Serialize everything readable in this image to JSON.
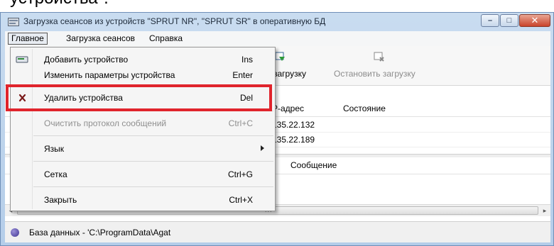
{
  "caption": "устройства\".",
  "window": {
    "title": "Загрузка сеансов из устройств \"SPRUT NR\", \"SPRUT SR\" в оперативную БД",
    "minimize_glyph": "–",
    "maximize_glyph": "□",
    "close_glyph": "✕"
  },
  "menubar": {
    "items": [
      {
        "label": "Главное"
      },
      {
        "label": "Загрузка сеансов"
      },
      {
        "label": "Справка"
      }
    ]
  },
  "toolbar": {
    "start_load_label": "загрузку",
    "stop_load_label": "Остановить загрузку"
  },
  "devices_table": {
    "columns": [
      "P-адрес",
      "Состояние"
    ],
    "rows": [
      {
        "ip": "135.22.132",
        "state": ""
      },
      {
        "ip": "135.22.189",
        "state": ""
      }
    ]
  },
  "messages_table": {
    "columns": [
      "Сообщение"
    ]
  },
  "scrollbar": {
    "left_arrow": "◂",
    "right_arrow": "▸",
    "grip": "III"
  },
  "statusbar": {
    "text": "База данных - 'C:\\ProgramData\\Agat"
  },
  "dropdown": {
    "items": [
      {
        "label": "Добавить устройство",
        "shortcut": "Ins",
        "icon": "add-device-icon"
      },
      {
        "label": "Изменить параметры устройства",
        "shortcut": "Enter"
      },
      {
        "label": "Удалить устройства",
        "shortcut": "Del",
        "icon": "delete-x-icon"
      },
      {
        "label": "Очистить протокол сообщений",
        "shortcut": "Ctrl+C",
        "disabled": true
      },
      {
        "label": "Язык",
        "shortcut": ""
      },
      {
        "label": "Сетка",
        "shortcut": "Ctrl+G"
      },
      {
        "label": "Закрыть",
        "shortcut": "Ctrl+X"
      }
    ]
  },
  "colors": {
    "highlight": "#e0242c",
    "title_gradient_top": "#c9dcf0",
    "close_button": "#c9432a",
    "status_dot": "#3f3493"
  }
}
